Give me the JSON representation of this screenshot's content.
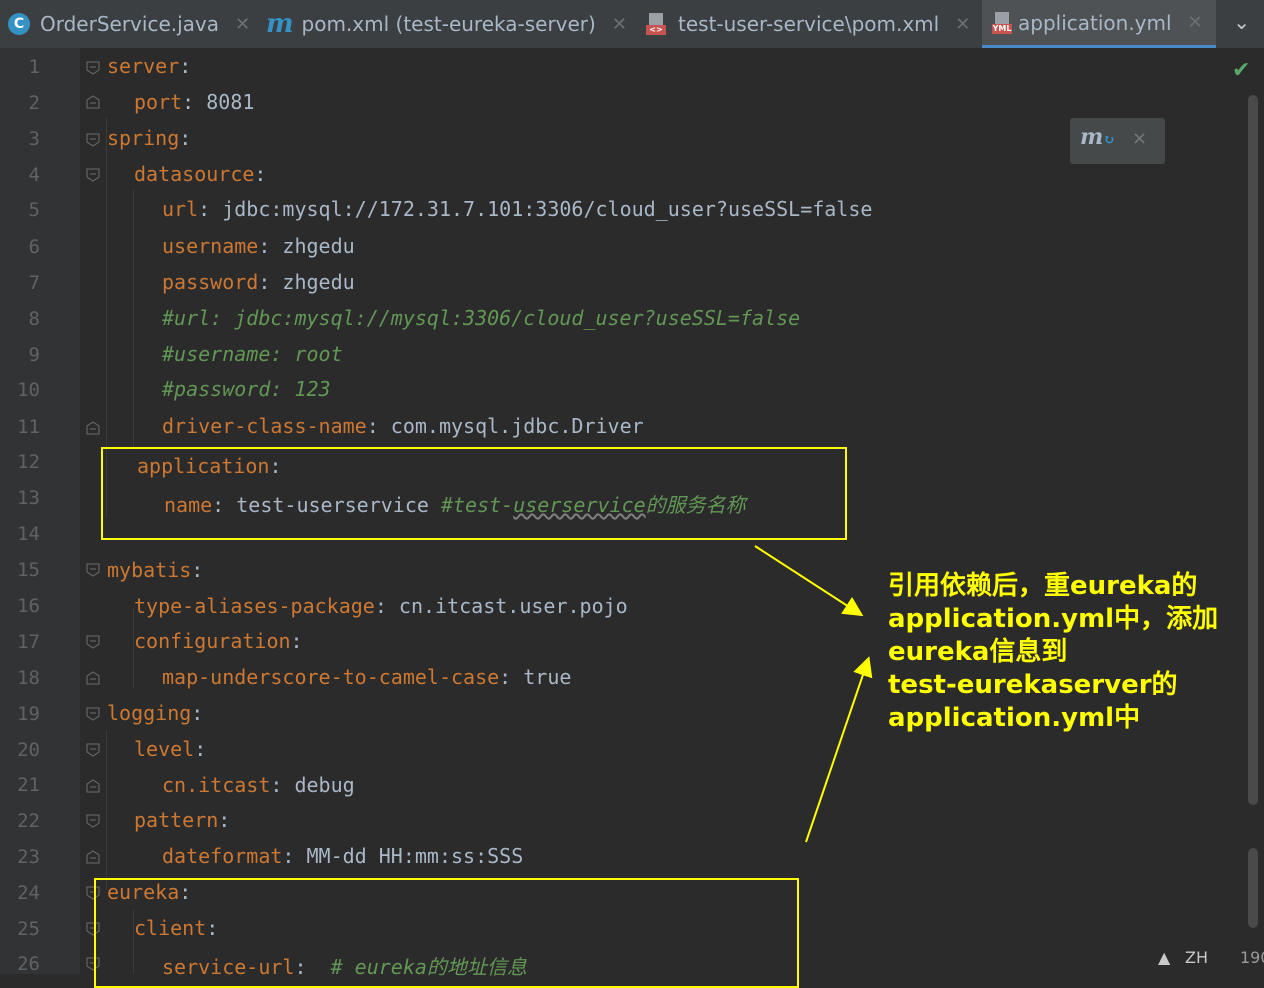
{
  "tabs": [
    {
      "label": "OrderService.java",
      "icon": "java-class-icon",
      "active": false
    },
    {
      "label": "pom.xml (test-eureka-server)",
      "icon": "maven-icon",
      "active": false
    },
    {
      "label": "test-user-service\\pom.xml",
      "icon": "xml-file-icon",
      "active": false
    },
    {
      "label": "application.yml",
      "icon": "yml-file-icon",
      "active": true
    }
  ],
  "line_numbers": [
    "1",
    "2",
    "3",
    "4",
    "5",
    "6",
    "7",
    "8",
    "9",
    "10",
    "11",
    "12",
    "13",
    "14",
    "15",
    "16",
    "17",
    "18",
    "19",
    "20",
    "21",
    "22",
    "23",
    "24",
    "25",
    "26"
  ],
  "code": {
    "l1": {
      "key": "server",
      "sep": ":"
    },
    "l2": {
      "key": "port",
      "sep": ": ",
      "val": "8081"
    },
    "l3": {
      "key": "spring",
      "sep": ":"
    },
    "l4": {
      "key": "datasource",
      "sep": ":"
    },
    "l5": {
      "key": "url",
      "sep": ": ",
      "val": "jdbc:mysql://172.31.7.101:3306/cloud_user?useSSL=false"
    },
    "l6": {
      "key": "username",
      "sep": ": ",
      "val": "zhgedu"
    },
    "l7": {
      "key": "password",
      "sep": ": ",
      "val": "zhgedu"
    },
    "l8": {
      "comment": "#url: jdbc:mysql://mysql:3306/cloud_user?useSSL=false"
    },
    "l9": {
      "comment": "#username: root"
    },
    "l10": {
      "comment": "#password: 123"
    },
    "l11": {
      "key": "driver-class-name",
      "sep": ": ",
      "val": "com.mysql.jdbc.Driver"
    },
    "l12": {
      "key": "application",
      "sep": ":"
    },
    "l13": {
      "key": "name",
      "sep": ": ",
      "val": "test-userservice ",
      "comment_a": "#test-",
      "comment_b": "userservice",
      "comment_c": "的服务名称"
    },
    "l15": {
      "key": "mybatis",
      "sep": ":"
    },
    "l16": {
      "key": "type-aliases-package",
      "sep": ": ",
      "val": "cn.itcast.user.pojo"
    },
    "l17": {
      "key": "configuration",
      "sep": ":"
    },
    "l18": {
      "key": "map-underscore-to-camel-case",
      "sep": ": ",
      "val": "true"
    },
    "l19": {
      "key": "logging",
      "sep": ":"
    },
    "l20": {
      "key": "level",
      "sep": ":"
    },
    "l21": {
      "key": "cn.itcast",
      "sep": ": ",
      "val": "debug"
    },
    "l22": {
      "key": "pattern",
      "sep": ":"
    },
    "l23": {
      "key": "dateformat",
      "sep": ": ",
      "val": "MM-dd HH:mm:ss:SSS"
    },
    "l24": {
      "key": "eureka",
      "sep": ":"
    },
    "l25": {
      "key": "client",
      "sep": ":"
    },
    "l26": {
      "key": "service-url",
      "sep": ":  ",
      "comment": "# eureka的地址信息"
    }
  },
  "annotation": {
    "line1": "引用依赖后，重eureka的",
    "line2": "application.yml中，添加",
    "line3": "eureka信息到",
    "line4": "test-eurekaserver的",
    "line5": "application.yml中"
  },
  "floating_toolbar": {
    "icon": "maven-reload-icon",
    "close": "×"
  },
  "status": {
    "language": "ZH",
    "position": "190"
  },
  "colors": {
    "key": "#cc7832",
    "value": "#a9b7c6",
    "comment": "#629755",
    "highlight": "#ffff00",
    "background": "#2b2b2b"
  }
}
